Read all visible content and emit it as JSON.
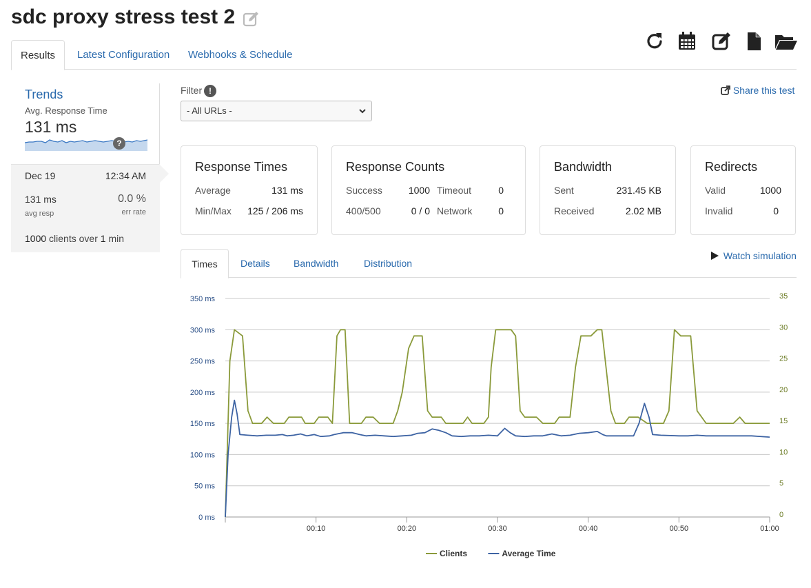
{
  "page": {
    "title": "sdc proxy stress test 2"
  },
  "tabs": [
    "Results",
    "Latest Configuration",
    "Webhooks & Schedule"
  ],
  "toolbar": [
    "refresh-icon",
    "calendar-icon",
    "edit-icon",
    "document-icon",
    "folder-open-icon"
  ],
  "sidebar": {
    "trends_label": "Trends",
    "avg_label": "Avg. Response Time",
    "avg_value": "131 ms",
    "help": "?",
    "run": {
      "date": "Dec 19",
      "time": "12:34 AM",
      "avg_resp": "131 ms",
      "avg_resp_label": "avg resp",
      "err_rate": "0.0 %",
      "err_rate_label": "err rate",
      "clients": "1000",
      "clients_mid": "clients over",
      "duration": "1",
      "duration_unit": "min"
    }
  },
  "filter": {
    "label": "Filter",
    "info": "!",
    "selected": "- All URLs -"
  },
  "share_label": "Share this test",
  "cards": {
    "response_times": {
      "title": "Response Times",
      "average_label": "Average",
      "average": "131 ms",
      "minmax_label": "Min/Max",
      "minmax": "125 / 206 ms"
    },
    "response_counts": {
      "title": "Response Counts",
      "success_label": "Success",
      "success": "1000",
      "timeout_label": "Timeout",
      "timeout": "0",
      "err_label": "400/500",
      "err": "0 / 0",
      "network_label": "Network",
      "network": "0"
    },
    "bandwidth": {
      "title": "Bandwidth",
      "sent_label": "Sent",
      "sent": "231.45 KB",
      "received_label": "Received",
      "received": "2.02 MB"
    },
    "redirects": {
      "title": "Redirects",
      "valid_label": "Valid",
      "valid": "1000",
      "invalid_label": "Invalid",
      "invalid": "0"
    }
  },
  "chart_tabs": [
    "Times",
    "Details",
    "Bandwidth",
    "Distribution"
  ],
  "watch_label": "Watch simulation",
  "colors": {
    "clients": "#8a9a3a",
    "average_time": "#3d63a3",
    "link": "#2a6aad"
  },
  "chart_data": {
    "type": "line",
    "x_unit": "seconds",
    "x_ticks": [
      "00:10",
      "00:20",
      "00:30",
      "00:40",
      "00:50",
      "01:00"
    ],
    "x_tick_values": [
      10,
      20,
      30,
      40,
      50,
      60
    ],
    "xlim": [
      0,
      60
    ],
    "y_left": {
      "ticks": [
        "0 ms",
        "50 ms",
        "100 ms",
        "150 ms",
        "200 ms",
        "250 ms",
        "300 ms",
        "350 ms"
      ],
      "ylim": [
        0,
        350
      ]
    },
    "y_right": {
      "ticks": [
        "0",
        "5",
        "10",
        "15",
        "20",
        "25",
        "30",
        "35"
      ],
      "ylim": [
        0,
        35
      ]
    },
    "legend_position": "bottom-center",
    "series": [
      {
        "name": "Clients",
        "axis": "right",
        "points": [
          [
            0,
            0
          ],
          [
            0.5,
            25
          ],
          [
            1,
            30
          ],
          [
            1.9,
            29
          ],
          [
            2.5,
            17
          ],
          [
            3,
            15
          ],
          [
            4,
            15
          ],
          [
            4.6,
            16
          ],
          [
            5.3,
            15
          ],
          [
            6,
            15
          ],
          [
            6.5,
            15
          ],
          [
            7,
            16
          ],
          [
            8.4,
            16
          ],
          [
            8.8,
            15
          ],
          [
            9.8,
            15
          ],
          [
            10.3,
            16
          ],
          [
            11.3,
            16
          ],
          [
            11.8,
            15
          ],
          [
            12.3,
            29
          ],
          [
            12.7,
            30
          ],
          [
            13.2,
            30
          ],
          [
            13.7,
            15
          ],
          [
            15,
            15
          ],
          [
            15.5,
            16
          ],
          [
            16.3,
            16
          ],
          [
            17,
            15
          ],
          [
            18.5,
            15
          ],
          [
            19,
            17
          ],
          [
            19.5,
            20
          ],
          [
            20.2,
            27
          ],
          [
            20.8,
            29
          ],
          [
            21.7,
            29
          ],
          [
            22.3,
            17
          ],
          [
            22.8,
            16
          ],
          [
            23.8,
            16
          ],
          [
            24.3,
            15
          ],
          [
            25.3,
            15
          ],
          [
            26.2,
            15
          ],
          [
            26.7,
            16
          ],
          [
            27.2,
            15
          ],
          [
            28.5,
            15
          ],
          [
            29,
            16
          ],
          [
            29.3,
            24
          ],
          [
            29.8,
            30
          ],
          [
            31.5,
            30
          ],
          [
            32,
            29
          ],
          [
            32.5,
            17
          ],
          [
            33,
            16
          ],
          [
            33.8,
            16
          ],
          [
            34.3,
            16
          ],
          [
            35,
            15
          ],
          [
            36.3,
            15
          ],
          [
            36.8,
            16
          ],
          [
            38,
            16
          ],
          [
            38.6,
            24
          ],
          [
            39.2,
            29
          ],
          [
            40.3,
            29
          ],
          [
            41,
            30
          ],
          [
            41.5,
            30
          ],
          [
            42.5,
            17
          ],
          [
            43,
            15
          ],
          [
            44,
            15
          ],
          [
            44.5,
            16
          ],
          [
            45.5,
            16
          ],
          [
            46.5,
            15
          ],
          [
            48.3,
            15
          ],
          [
            48.9,
            17
          ],
          [
            49.5,
            30
          ],
          [
            50.2,
            29
          ],
          [
            50.6,
            29
          ],
          [
            51.3,
            29
          ],
          [
            52,
            17
          ],
          [
            53,
            15
          ],
          [
            55,
            15
          ],
          [
            56,
            15
          ],
          [
            56.7,
            16
          ],
          [
            57.3,
            15
          ],
          [
            58,
            15
          ],
          [
            60,
            15
          ]
        ]
      },
      {
        "name": "Average Time",
        "axis": "left",
        "points": [
          [
            0,
            0
          ],
          [
            0.3,
            100
          ],
          [
            0.7,
            160
          ],
          [
            1,
            187
          ],
          [
            1.3,
            165
          ],
          [
            1.6,
            132
          ],
          [
            2.5,
            131
          ],
          [
            3.5,
            130
          ],
          [
            4.5,
            131
          ],
          [
            5.5,
            131
          ],
          [
            6.3,
            132
          ],
          [
            6.8,
            130
          ],
          [
            7.5,
            131
          ],
          [
            8.3,
            133
          ],
          [
            9,
            130
          ],
          [
            9.8,
            132
          ],
          [
            10.5,
            129
          ],
          [
            11.5,
            130
          ],
          [
            12,
            132
          ],
          [
            13,
            135
          ],
          [
            14,
            135
          ],
          [
            14.8,
            132
          ],
          [
            15.5,
            130
          ],
          [
            16.5,
            131
          ],
          [
            17.5,
            130
          ],
          [
            18.5,
            129
          ],
          [
            19.5,
            130
          ],
          [
            20.5,
            131
          ],
          [
            21.2,
            134
          ],
          [
            22,
            135
          ],
          [
            22.8,
            141
          ],
          [
            23.5,
            139
          ],
          [
            24.3,
            135
          ],
          [
            25,
            130
          ],
          [
            26,
            129
          ],
          [
            27,
            130
          ],
          [
            28,
            130
          ],
          [
            29,
            131
          ],
          [
            30,
            130
          ],
          [
            30.8,
            142
          ],
          [
            31.4,
            135
          ],
          [
            32,
            130
          ],
          [
            33,
            129
          ],
          [
            34,
            130
          ],
          [
            35,
            130
          ],
          [
            36,
            133
          ],
          [
            37,
            130
          ],
          [
            38,
            131
          ],
          [
            39,
            134
          ],
          [
            40,
            135
          ],
          [
            41,
            137
          ],
          [
            41.6,
            132
          ],
          [
            42,
            130
          ],
          [
            43,
            130
          ],
          [
            44,
            130
          ],
          [
            45,
            130
          ],
          [
            45.6,
            150
          ],
          [
            46.2,
            182
          ],
          [
            46.7,
            160
          ],
          [
            47.1,
            132
          ],
          [
            48,
            131
          ],
          [
            50,
            130
          ],
          [
            51,
            130
          ],
          [
            52,
            131
          ],
          [
            53,
            130
          ],
          [
            54,
            130
          ],
          [
            56,
            130
          ],
          [
            58,
            130
          ],
          [
            60,
            128
          ]
        ]
      }
    ]
  }
}
